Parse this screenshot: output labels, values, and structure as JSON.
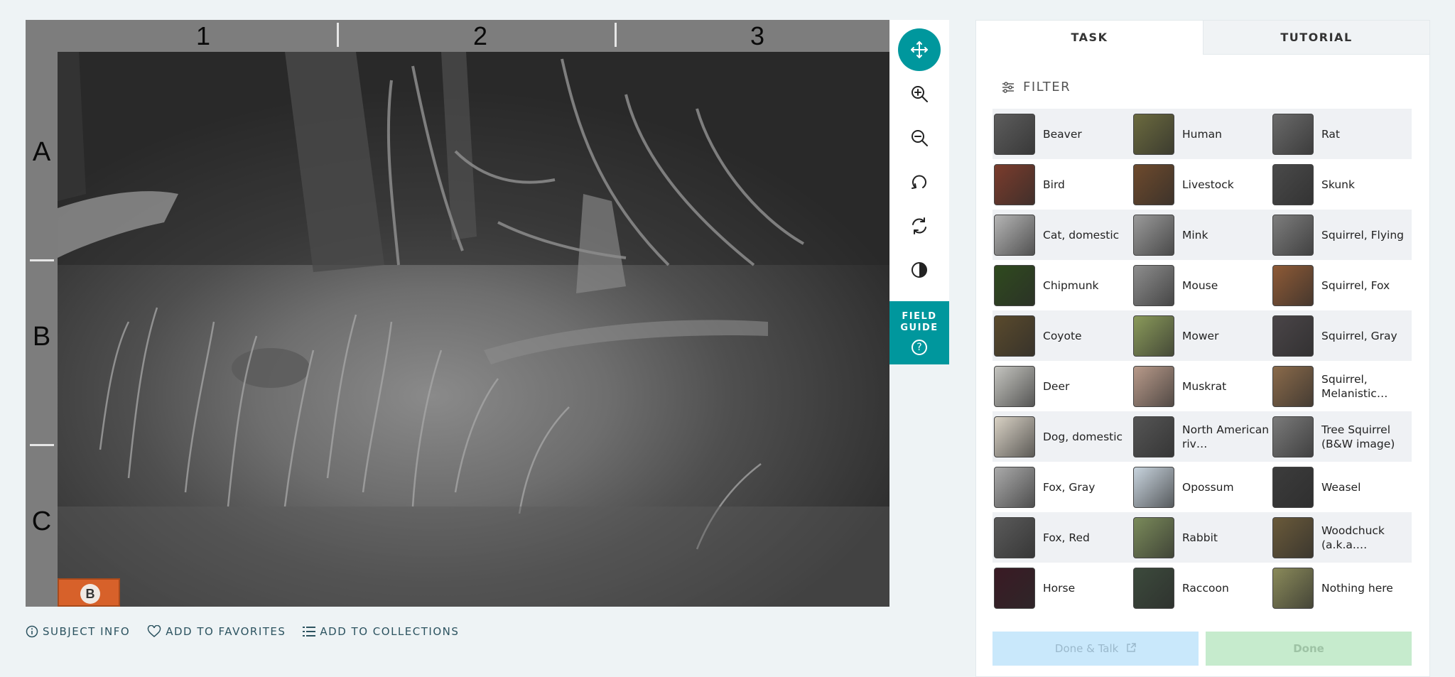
{
  "viewer": {
    "column_labels": [
      "1",
      "2",
      "3"
    ],
    "row_labels": [
      "A",
      "B",
      "C"
    ],
    "camera_logo": "B"
  },
  "toolbar": {
    "tools": [
      "move-icon",
      "zoom-in-icon",
      "zoom-out-icon",
      "rotate-icon",
      "reset-icon",
      "invert-icon"
    ],
    "field_guide_label_line1": "FIELD",
    "field_guide_label_line2": "GUIDE",
    "field_guide_icon": "?",
    "accent_color": "#00979d"
  },
  "meta": {
    "subject_info": "SUBJECT INFO",
    "add_to_favorites": "ADD TO FAVORITES",
    "add_to_collections": "ADD TO COLLECTIONS"
  },
  "panel": {
    "tabs": [
      "TASK",
      "TUTORIAL"
    ],
    "filter_label": "FILTER",
    "choices": [
      {
        "label": "Beaver",
        "thumb": "#5d5d5d"
      },
      {
        "label": "Human",
        "thumb": "#6b6a3e"
      },
      {
        "label": "Rat",
        "thumb": "#6a6a6a"
      },
      {
        "label": "Bird",
        "thumb": "#7b3c2c"
      },
      {
        "label": "Livestock",
        "thumb": "#6e4a2c"
      },
      {
        "label": "Skunk",
        "thumb": "#4a4a4a"
      },
      {
        "label": "Cat, domestic",
        "thumb": "#b5b5b5"
      },
      {
        "label": "Mink",
        "thumb": "#9a9a9a"
      },
      {
        "label": "Squirrel, Flying",
        "thumb": "#7d7d7d"
      },
      {
        "label": "Chipmunk",
        "thumb": "#2f4a1e"
      },
      {
        "label": "Mouse",
        "thumb": "#8d8d8d"
      },
      {
        "label": "Squirrel, Fox",
        "thumb": "#8e5a36"
      },
      {
        "label": "Coyote",
        "thumb": "#5a4a2c"
      },
      {
        "label": "Mower",
        "thumb": "#8a9a5a"
      },
      {
        "label": "Squirrel, Gray",
        "thumb": "#4a4548"
      },
      {
        "label": "Deer",
        "thumb": "#c5c5c0"
      },
      {
        "label": "Muskrat",
        "thumb": "#b89a8a"
      },
      {
        "label": "Squirrel, Melanistic…",
        "thumb": "#8a6a4a"
      },
      {
        "label": "Dog, domestic",
        "thumb": "#d9d2c5"
      },
      {
        "label": "North American riv…",
        "thumb": "#555555"
      },
      {
        "label": "Tree Squirrel (B&W image)",
        "thumb": "#7a7a7a"
      },
      {
        "label": "Fox, Gray",
        "thumb": "#aaaaaa"
      },
      {
        "label": "Opossum",
        "thumb": "#c8d4de"
      },
      {
        "label": "Weasel",
        "thumb": "#3c3c3c"
      },
      {
        "label": "Fox, Red",
        "thumb": "#5a5a5a"
      },
      {
        "label": "Rabbit",
        "thumb": "#7a8a5a"
      },
      {
        "label": "Woodchuck (a.k.a.…",
        "thumb": "#6a5a3a"
      },
      {
        "label": "Horse",
        "thumb": "#3a1a24"
      },
      {
        "label": "Raccoon",
        "thumb": "#3c4a3c"
      },
      {
        "label": "Nothing here",
        "thumb": "#8a8a5a"
      }
    ],
    "done_talk_label": "Done & Talk",
    "done_label": "Done"
  }
}
